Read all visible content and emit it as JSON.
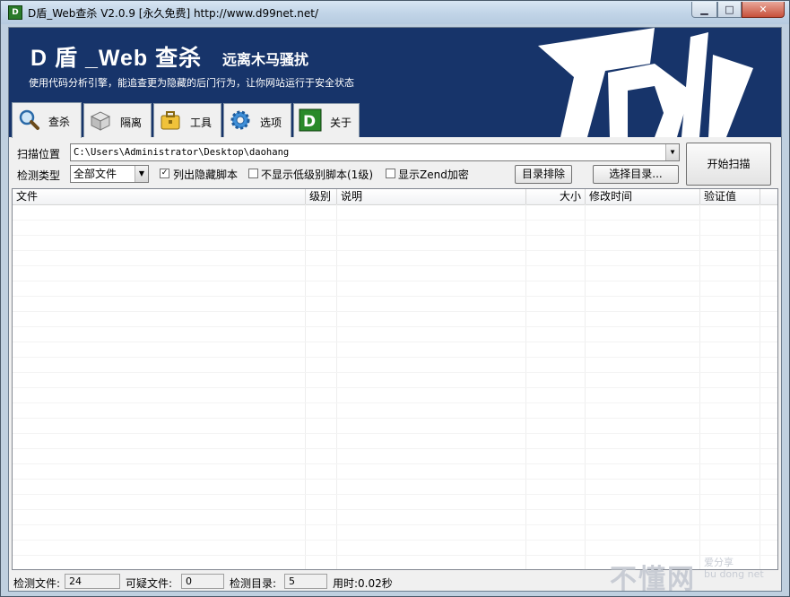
{
  "window": {
    "title": "D盾_Web查杀 V2.0.9 [永久免费] http://www.d99net.net/",
    "min_label": "▁",
    "max_label": "□",
    "close_label": "✕"
  },
  "banner": {
    "brand": "D 盾 _Web 查杀",
    "subtitle": "远离木马骚扰",
    "tagline": "使用代码分析引擎，能追查更为隐藏的后门行为，让你网站运行于安全状态"
  },
  "tabs": [
    {
      "label": "查杀",
      "icon": "magnifier-icon"
    },
    {
      "label": "隔离",
      "icon": "box-icon"
    },
    {
      "label": "工具",
      "icon": "toolbox-icon"
    },
    {
      "label": "选项",
      "icon": "gear-icon"
    },
    {
      "label": "关于",
      "icon": "d-logo-icon"
    }
  ],
  "scan": {
    "location_label": "扫描位置",
    "path_value": "C:\\Users\\Administrator\\Desktop\\daohang",
    "type_label": "检测类型",
    "type_value": "全部文件",
    "chk_hidden_label": "列出隐藏脚本",
    "chk_hidden_checked": true,
    "chk_lowlevel_label": "不显示低级别脚本(1级)",
    "chk_lowlevel_checked": false,
    "chk_zend_label": "显示Zend加密",
    "chk_zend_checked": false,
    "exclude_button": "目录排除",
    "choose_dir_button": "选择目录...",
    "start_button": "开始扫描"
  },
  "table": {
    "columns": [
      "文件",
      "级别",
      "说明",
      "大小",
      "修改时间",
      "验证值"
    ],
    "rows": []
  },
  "status": {
    "files_label": "检测文件:",
    "files_value": "24",
    "suspicious_label": "可疑文件:",
    "suspicious_value": "0",
    "dirs_label": "检测目录:",
    "dirs_value": "5",
    "time_text": "用时:0.02秒"
  },
  "watermark": {
    "main": "不懂网",
    "sub_line1": "爱分享",
    "sub_line2": "bu dong net"
  },
  "colors": {
    "banner_bg": "#17346a",
    "accent_green": "#2a7a2a"
  }
}
